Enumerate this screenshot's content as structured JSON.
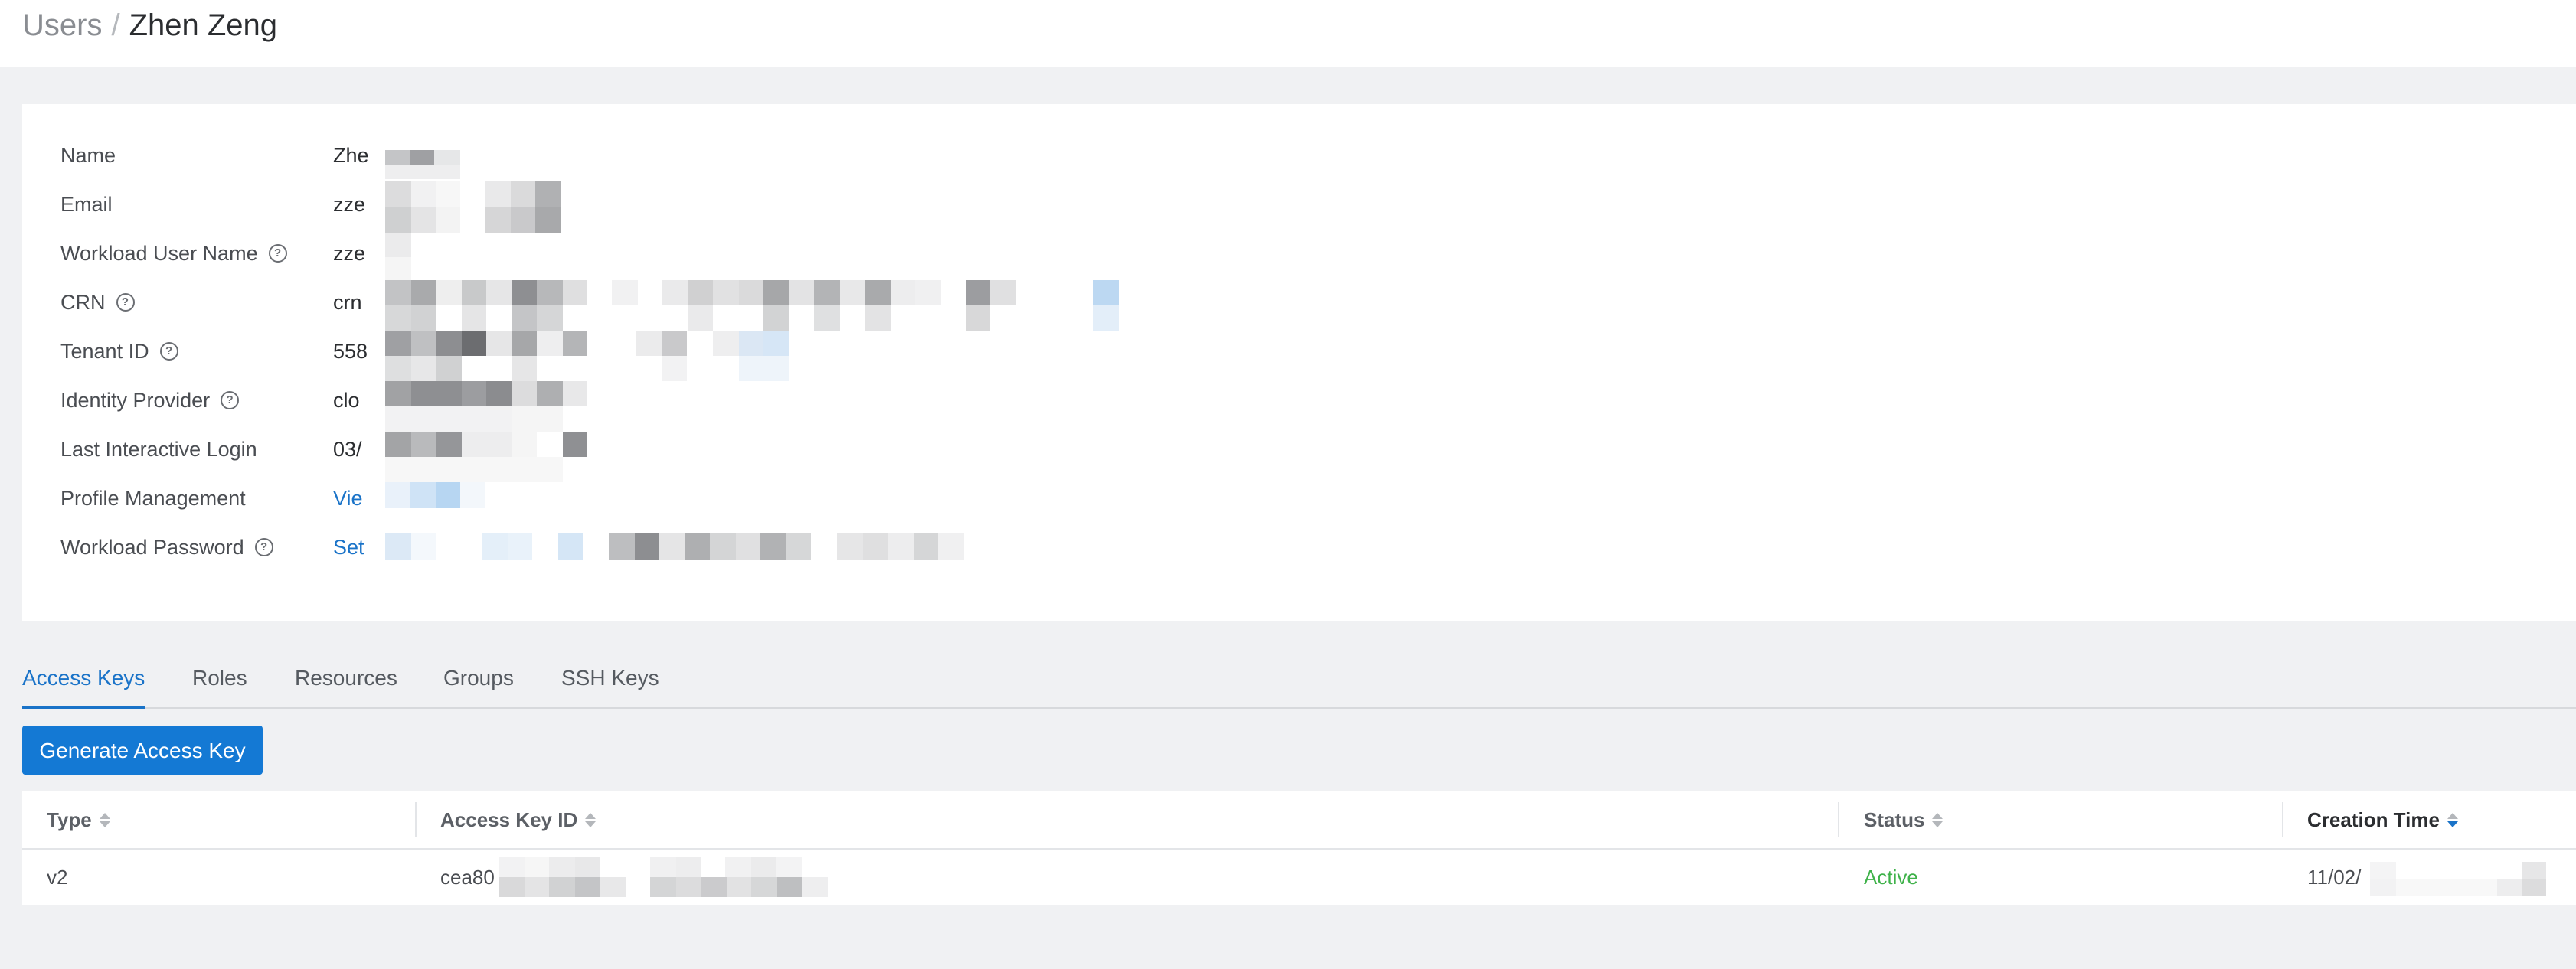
{
  "breadcrumb": {
    "parent": "Users",
    "separator": "/",
    "current": "Zhen Zeng"
  },
  "details": {
    "fields": [
      {
        "label": "Name",
        "value": "Zhe",
        "help": false,
        "link": false
      },
      {
        "label": "Email",
        "value": "zze",
        "help": false,
        "link": false
      },
      {
        "label": "Workload User Name",
        "value": "zze",
        "help": true,
        "link": false
      },
      {
        "label": "CRN",
        "value": "crn",
        "help": true,
        "link": false
      },
      {
        "label": "Tenant ID",
        "value": "558",
        "help": true,
        "link": false
      },
      {
        "label": "Identity Provider",
        "value": "clo",
        "help": true,
        "link": false
      },
      {
        "label": "Last Interactive Login",
        "value": "03/",
        "help": false,
        "link": false
      },
      {
        "label": "Profile Management",
        "value": "Vie",
        "help": false,
        "link": true
      },
      {
        "label": "Workload Password",
        "value": "Set",
        "help": true,
        "link": true
      }
    ],
    "help_icon": "question-circle-icon"
  },
  "tabs": [
    {
      "label": "Access Keys",
      "active": true
    },
    {
      "label": "Roles",
      "active": false
    },
    {
      "label": "Resources",
      "active": false
    },
    {
      "label": "Groups",
      "active": false
    },
    {
      "label": "SSH Keys",
      "active": false
    }
  ],
  "generate_button": {
    "label": "Generate Access Key"
  },
  "table": {
    "columns": [
      {
        "label": "Type",
        "sort": "none"
      },
      {
        "label": "Access Key ID",
        "sort": "none"
      },
      {
        "label": "Status",
        "sort": "none"
      },
      {
        "label": "Creation Time",
        "sort": "descending"
      }
    ],
    "rows": [
      {
        "type": "v2",
        "access_key_id": "cea80",
        "status": "Active",
        "creation_time": "11/02/"
      }
    ]
  },
  "colors": {
    "accent": "#1a73c8",
    "button": "#1479d4",
    "status_active": "#3fb24a",
    "background": "#f0f1f3"
  }
}
